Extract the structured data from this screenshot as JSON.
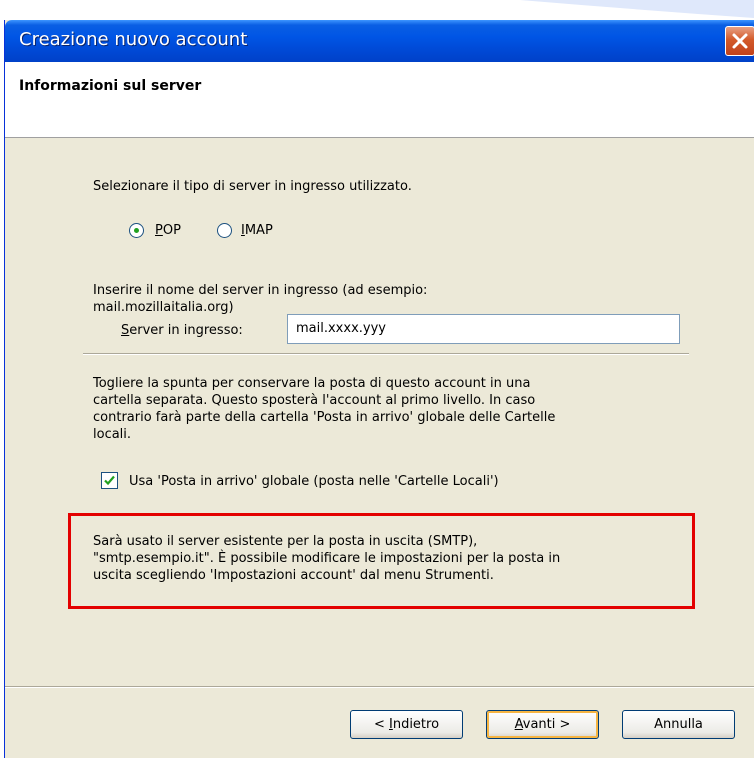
{
  "window": {
    "title": "Creazione nuovo account"
  },
  "header": {
    "title": "Informazioni sul server"
  },
  "server_type": {
    "prompt": "Selezionare il tipo di server in ingresso utilizzato.",
    "options": [
      {
        "label": "POP",
        "selected": true
      },
      {
        "label": "IMAP",
        "selected": false
      }
    ]
  },
  "incoming": {
    "instructions_line1": "Inserire il nome del server in ingresso (ad esempio:",
    "instructions_line2": "mail.mozillaitalia.org)",
    "field_label": "Server in ingresso:",
    "field_value": "mail.xxxx.yyy"
  },
  "global_inbox": {
    "text_lines": [
      "Togliere la spunta per conservare la posta di questo account in una",
      "cartella separata. Questo sposterà l'account al primo livello. In caso",
      "contrario farà parte della cartella 'Posta in arrivo' globale delle Cartelle",
      "locali."
    ],
    "checkbox_label": "Usa 'Posta in arrivo' globale (posta nelle 'Cartelle Locali')",
    "checked": true
  },
  "smtp_note": {
    "lines": [
      "Sarà usato il server esistente per la posta in uscita (SMTP),",
      "\"smtp.esempio.it\". È possibile modificare le impostazioni per la posta in",
      "uscita scegliendo 'Impostazioni account' dal menu Strumenti."
    ]
  },
  "buttons": {
    "back": "< Indietro",
    "next": "Avanti >",
    "cancel": "Annulla"
  },
  "colors": {
    "titlebar": "#0055e5",
    "dialog_bg": "#ECE9D8",
    "highlight_box": "#e30000",
    "radio_dot": "#21a121",
    "check": "#21a121"
  }
}
